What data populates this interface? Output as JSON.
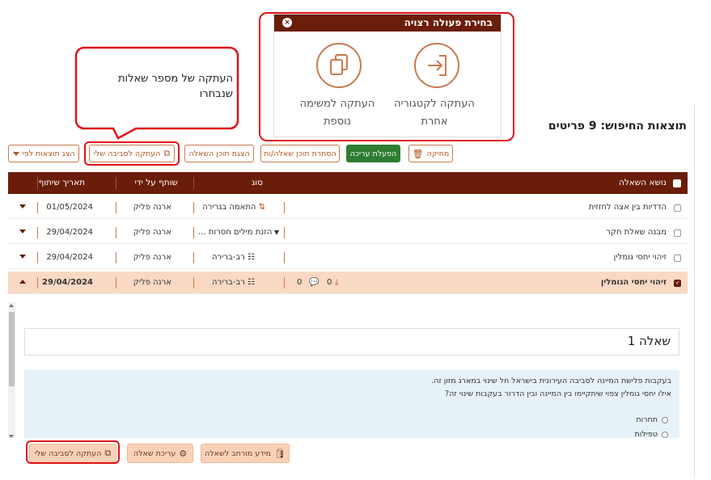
{
  "popup": {
    "title": "בחירת פעולה רצויה",
    "copy_to_category": "העתקה לקטגוריה אחרת",
    "copy_to_task": "העתקה למשימה נוספת"
  },
  "callout": {
    "text": "העתקה של מספר שאלות שנבחרו"
  },
  "results_title": "תוצאות החיפוש: 9 פריטים",
  "toolbar": {
    "delete": "מחיקה",
    "edit": "הפעלת עריכה",
    "hide_content": "הסתרת תוכן שאלה/ות",
    "show_content": "הצגת תוכן השאלה",
    "copy_env": "העתקה לסביבה שלי",
    "show_by": "הצג תוצאות לפי"
  },
  "table": {
    "headers": {
      "subject": "נושא השאלה",
      "type": "סוג",
      "shared_by": "שותף על ידי",
      "share_date": "תאריך שיתוף"
    },
    "rows": [
      {
        "subject": "הדדיות בין אצה לחזזית",
        "type": "התאמה בגרירה",
        "shared_by": "ארנה פליק",
        "date": "01/05/2024"
      },
      {
        "subject": "מבנה שאלת חקר",
        "type": "הזנת מילים חסרות ...",
        "shared_by": "ארנה פליק",
        "date": "29/04/2024"
      },
      {
        "subject": "זיהוי יחסי גומלין",
        "type": "רב-ברירה",
        "shared_by": "ארנה פליק",
        "date": "29/04/2024"
      },
      {
        "subject": "זיהוי יחסי הגומלין",
        "type": "רב-ברירה",
        "shared_by": "ארנה פליק",
        "date": "29/04/2024",
        "comments": "0",
        "downloads": "0"
      }
    ]
  },
  "detail": {
    "question_title": "שאלה 1",
    "text_line1": "בעקבות פלישת המיינה לסביבה העירונית בישראל חל שינוי במארג מזון זה.",
    "text_line2": "אילו יחסי גומלין צפוי שיתקיימו בין המיינה ובין הדרור בעקבות שינוי זה?",
    "options": [
      "תחרות",
      "טפילות"
    ],
    "btn_info": "מידע מורחב לשאלה",
    "btn_edit": "עריכת שאלה",
    "btn_copy": "העתקה לסביבה שלי"
  },
  "colors": {
    "header_brown": "#6a1d08",
    "accent_orange": "#c87a4e",
    "highlight_red": "#e0121a",
    "edit_green": "#2e7d32",
    "active_row": "#f9d9c4",
    "question_bg": "#e6f2f8"
  }
}
